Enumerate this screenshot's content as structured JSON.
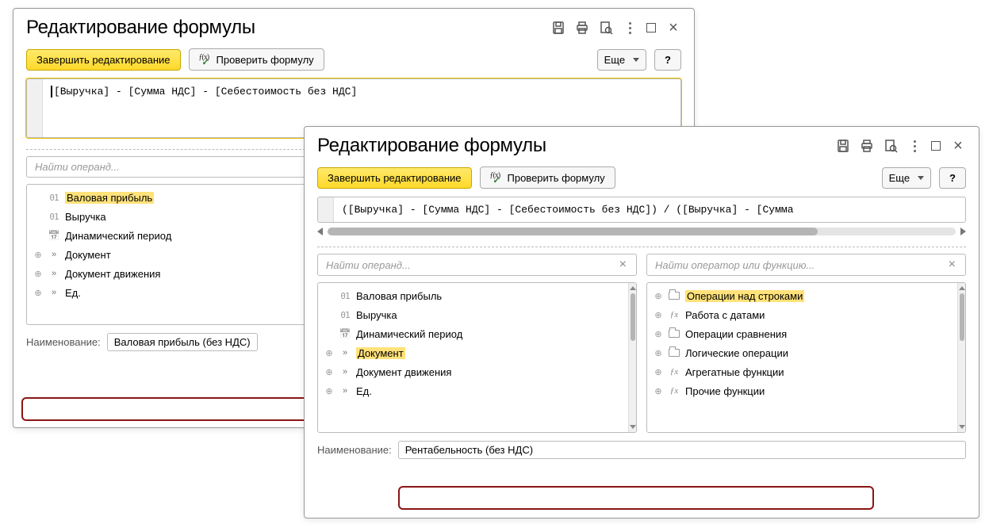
{
  "common": {
    "window_title": "Редактирование формулы",
    "btn_finish": "Завершить редактирование",
    "btn_check": "Проверить формулу",
    "btn_more": "Еще",
    "btn_help": "?",
    "search_operand_ph": "Найти операнд...",
    "search_func_ph": "Найти оператор или функцию...",
    "name_label": "Наименование:"
  },
  "operands": [
    {
      "icon": "01",
      "label": "Валовая прибыль"
    },
    {
      "icon": "01",
      "label": "Выручка"
    },
    {
      "icon": "cal",
      "label": "Динамический период"
    },
    {
      "icon": "chev",
      "expand": true,
      "label": "Документ"
    },
    {
      "icon": "chev",
      "expand": true,
      "label": "Документ движения"
    },
    {
      "icon": "chev",
      "expand": true,
      "label": "Ед."
    }
  ],
  "functions": [
    {
      "icon": "folder",
      "expand": true,
      "label": "Операции над строками"
    },
    {
      "icon": "fx",
      "expand": true,
      "label": "Работа с датами"
    },
    {
      "icon": "folder",
      "expand": true,
      "label": "Операции сравнения"
    },
    {
      "icon": "folder",
      "expand": true,
      "label": "Логические операции"
    },
    {
      "icon": "fx",
      "expand": true,
      "label": "Агрегатные функции"
    },
    {
      "icon": "fx",
      "expand": true,
      "label": "Прочие функции"
    }
  ],
  "win1": {
    "formula": "[Выручка] - [Сумма НДС] - [Себестоимость без НДС]",
    "name_value": "Валовая прибыль (без НДС)",
    "highlight_operand_index": 0
  },
  "win2": {
    "formula": "([Выручка] - [Сумма НДС] - [Себестоимость без НДС]) / ([Выручка] - [Сумма",
    "name_value": "Рентабельность (без НДС)",
    "highlight_operand_index": 3,
    "highlight_function_index": 0
  }
}
